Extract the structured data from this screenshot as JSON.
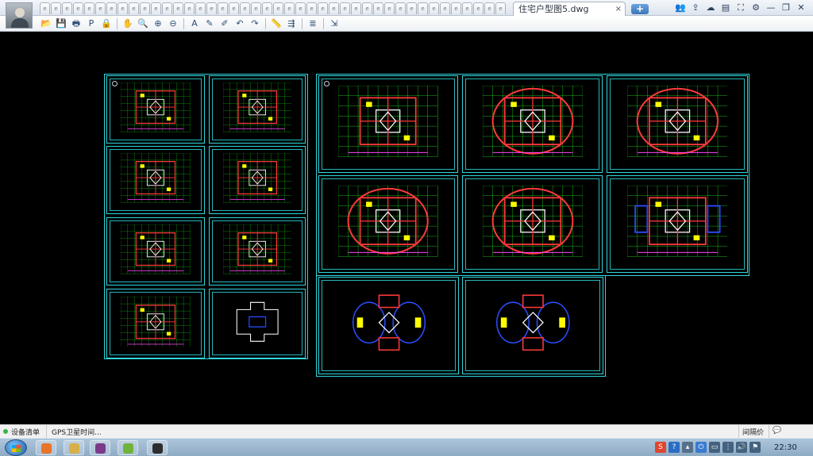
{
  "title_bar": {
    "document_tab_title": "住宅户型图5.dwg",
    "document_tab_close": "×",
    "new_tab_label": "+",
    "tab_placeholder_glyph": "e",
    "tab_count": 42,
    "window_icons": [
      {
        "name": "users-icon",
        "glyph": "👥"
      },
      {
        "name": "share-icon",
        "glyph": "⇪"
      },
      {
        "name": "cloud-icon",
        "glyph": "☁"
      },
      {
        "name": "layers-icon",
        "glyph": "▤"
      },
      {
        "name": "fullscreen-icon",
        "glyph": "⛶"
      },
      {
        "name": "settings-icon",
        "glyph": "⚙"
      },
      {
        "name": "minimize-icon",
        "glyph": "—"
      },
      {
        "name": "restore-icon",
        "glyph": "❐"
      },
      {
        "name": "close-icon",
        "glyph": "✕"
      }
    ]
  },
  "toolbar": {
    "groups": [
      [
        {
          "name": "open-icon",
          "glyph": "📂"
        },
        {
          "name": "save-icon",
          "glyph": "💾"
        },
        {
          "name": "print-icon",
          "glyph": "🖶"
        },
        {
          "name": "pdf-icon",
          "glyph": "P"
        },
        {
          "name": "lock-icon",
          "glyph": "🔒"
        }
      ],
      [
        {
          "name": "pan-icon",
          "glyph": "✋"
        },
        {
          "name": "zoom-window-icon",
          "glyph": "🔍"
        },
        {
          "name": "zoom-in-icon",
          "glyph": "⊕"
        },
        {
          "name": "zoom-out-icon",
          "glyph": "⊖"
        }
      ],
      [
        {
          "name": "text-icon",
          "glyph": "A"
        },
        {
          "name": "pencil-icon",
          "glyph": "✎"
        },
        {
          "name": "marker-icon",
          "glyph": "✐"
        },
        {
          "name": "undo-icon",
          "glyph": "↶"
        },
        {
          "name": "redo-icon",
          "glyph": "↷"
        }
      ],
      [
        {
          "name": "measure-icon",
          "glyph": "📏"
        },
        {
          "name": "dimension-icon",
          "glyph": "⇶"
        }
      ],
      [
        {
          "name": "layer-manager-icon",
          "glyph": "≣"
        }
      ],
      [
        {
          "name": "export-icon",
          "glyph": "⇲"
        }
      ]
    ]
  },
  "status_bar": {
    "item1": "设备清单",
    "item2": "GPS卫星时间...",
    "language": "间隔价",
    "chat_icon": "💬"
  },
  "taskbar": {
    "tray_icons": [
      {
        "name": "app-tray-icon",
        "glyph": "S",
        "color": "#e0452f"
      },
      {
        "name": "help-tray-icon",
        "glyph": "?",
        "color": "#2b6cc4"
      },
      {
        "name": "expand-tray-icon",
        "glyph": "▴",
        "color": "#55708a"
      },
      {
        "name": "power-tray-icon",
        "glyph": "⏻",
        "color": "#3a7ad0"
      },
      {
        "name": "monitor-tray-icon",
        "glyph": "▭",
        "color": "#44627f"
      },
      {
        "name": "network-tray-icon",
        "glyph": "⋮",
        "color": "#44627f"
      },
      {
        "name": "volume-tray-icon",
        "glyph": "🔊",
        "color": "#44627f"
      },
      {
        "name": "flag-tray-icon",
        "glyph": "⚑",
        "color": "#44627f"
      }
    ],
    "clock": "22:30",
    "task_buttons": [
      {
        "name": "browser-task",
        "color": "#e8732a"
      },
      {
        "name": "explorer-task",
        "color": "#d8b04a"
      },
      {
        "name": "stack-task",
        "color": "#7b3b8a"
      },
      {
        "name": "dwg-viewer-task",
        "color": "#6fb33c"
      },
      {
        "name": "avatar-task",
        "color": "#2d2d2d"
      }
    ]
  },
  "colors": {
    "sheet_border": "#2fd7de",
    "wall_red": "#ff3a3a",
    "grid_green": "#22ff22",
    "yellow": "#ffff00",
    "white": "#ffffff",
    "blue": "#2a4dff",
    "magenta": "#ff44ff"
  }
}
